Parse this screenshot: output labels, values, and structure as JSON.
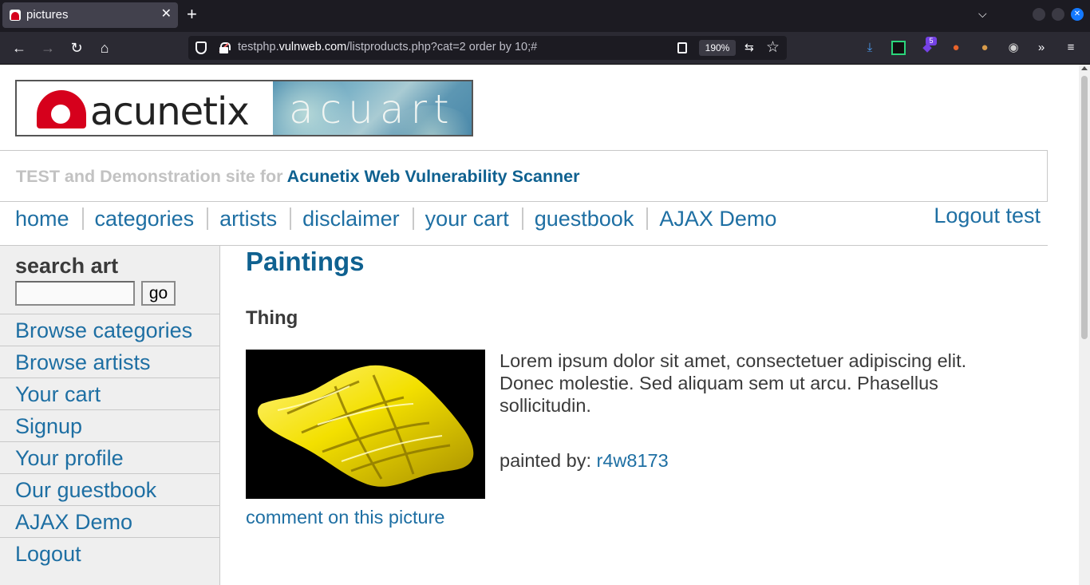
{
  "browser": {
    "tab_title": "pictures",
    "url_prefix": "testphp.",
    "url_host": "vulnweb.com",
    "url_path": "/listproducts.php?cat=2 order by 10;#",
    "zoom_level": "190%",
    "extension_badge_count": "5"
  },
  "header": {
    "logo_text_left": "acunetix",
    "logo_text_right": "acuart",
    "tagline_prefix": "TEST and Demonstration site for",
    "tagline_link": "Acunetix Web Vulnerability Scanner"
  },
  "global_nav": {
    "items": [
      "home",
      "categories",
      "artists",
      "disclaimer",
      "your cart",
      "guestbook",
      "AJAX Demo"
    ],
    "logout_label": "Logout test"
  },
  "sidebar": {
    "search_title": "search art",
    "search_value": "",
    "go_label": "go",
    "links": [
      "Browse categories",
      "Browse artists",
      "Your cart",
      "Signup",
      "Your profile",
      "Our guestbook",
      "AJAX Demo",
      "Logout"
    ]
  },
  "content": {
    "title": "Paintings",
    "item_title": "Thing",
    "description": "Lorem ipsum dolor sit amet, consectetuer adipiscing elit. Donec molestie. Sed aliquam sem ut arcu. Phasellus sollicitudin.",
    "painted_by_label": "painted by:",
    "artist": "r4w8173",
    "comment_link": "comment on this picture"
  },
  "colors": {
    "link": "#1e6fa3",
    "heading": "#0f6190",
    "tagline_gray": "#c2c2c2",
    "sidebar_bg": "#efefef",
    "browser_dark": "#1c1b22"
  }
}
